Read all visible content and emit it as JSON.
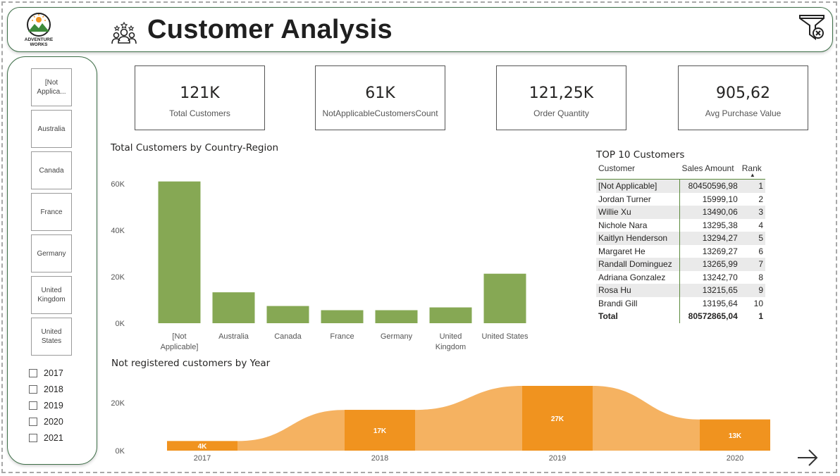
{
  "header": {
    "title": "Customer Analysis",
    "logo_text": [
      "ADVENTURE",
      "WORKS"
    ],
    "accent_color": "#3d6e47"
  },
  "icons": {
    "logo": "adventure-works-logo",
    "header": "customers-group-icon",
    "filter": "clear-filter-icon",
    "next": "arrow-right-icon"
  },
  "sidebar": {
    "countries": [
      "[Not Applica...",
      "Australia",
      "Canada",
      "France",
      "Germany",
      "United Kingdom",
      "United States"
    ],
    "years": [
      "2017",
      "2018",
      "2019",
      "2020",
      "2021"
    ]
  },
  "kpis": [
    {
      "value": "121K",
      "label": "Total Customers"
    },
    {
      "value": "61K",
      "label": "NotApplicableCustomersCount"
    },
    {
      "value": "121,25K",
      "label": "Order Quantity"
    },
    {
      "value": "905,62",
      "label": "Avg Purchase Value"
    }
  ],
  "top_customers": {
    "title": "TOP 10 Customers",
    "columns": [
      "Customer",
      "Sales Amount",
      "Rank"
    ],
    "sort_indicator": "▲",
    "rows": [
      {
        "customer": "[Not Applicable]",
        "sales": "80450596,98",
        "rank": "1"
      },
      {
        "customer": "Jordan Turner",
        "sales": "15999,10",
        "rank": "2"
      },
      {
        "customer": "Willie Xu",
        "sales": "13490,06",
        "rank": "3"
      },
      {
        "customer": "Nichole Nara",
        "sales": "13295,38",
        "rank": "4"
      },
      {
        "customer": "Kaitlyn Henderson",
        "sales": "13294,27",
        "rank": "5"
      },
      {
        "customer": "Margaret He",
        "sales": "13269,27",
        "rank": "6"
      },
      {
        "customer": "Randall Dominguez",
        "sales": "13265,99",
        "rank": "7"
      },
      {
        "customer": "Adriana Gonzalez",
        "sales": "13242,70",
        "rank": "8"
      },
      {
        "customer": "Rosa Hu",
        "sales": "13215,65",
        "rank": "9"
      },
      {
        "customer": "Brandi Gill",
        "sales": "13195,64",
        "rank": "10"
      }
    ],
    "total": {
      "customer": "Total",
      "sales": "80572865,04",
      "rank": "1"
    }
  },
  "chart_data": [
    {
      "type": "bar",
      "title": "Total Customers by Country-Region",
      "categories": [
        "[Not Applicable]",
        "Australia",
        "Canada",
        "France",
        "Germany",
        "United Kingdom",
        "United States"
      ],
      "category_label_lines": [
        [
          "[Not",
          "Applicable]"
        ],
        [
          "Australia"
        ],
        [
          "Canada"
        ],
        [
          "France"
        ],
        [
          "Germany"
        ],
        [
          "United",
          "Kingdom"
        ],
        [
          "United States"
        ]
      ],
      "values": [
        61000,
        13300,
        7400,
        5600,
        5600,
        6800,
        21300
      ],
      "ylim": [
        0,
        60000
      ],
      "yticks": [
        0,
        20000,
        40000,
        60000
      ],
      "ytick_labels": [
        "0K",
        "20K",
        "40K",
        "60K"
      ],
      "grid": false,
      "color": "#86a854"
    },
    {
      "type": "area",
      "title": "Not registered customers by Year",
      "categories": [
        "2017",
        "2018",
        "2019",
        "2020"
      ],
      "values": [
        4000,
        17000,
        27000,
        13000
      ],
      "data_labels": [
        "4K",
        "17K",
        "27K",
        "13K"
      ],
      "ylim": [
        0,
        27000
      ],
      "yticks": [
        0,
        20000
      ],
      "ytick_labels": [
        "0K",
        "20K"
      ],
      "grid": false,
      "bar_color": "#f0931f",
      "area_color": "#f5b261"
    }
  ]
}
